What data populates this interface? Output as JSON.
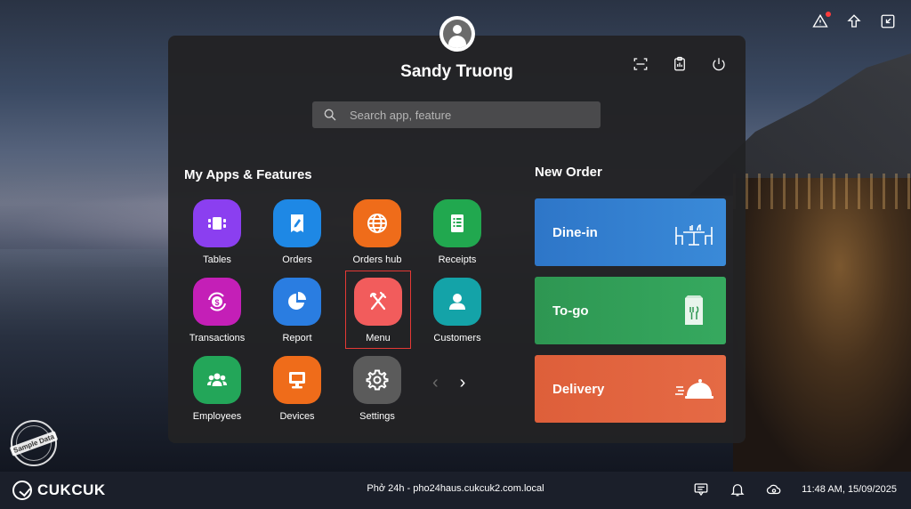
{
  "user": {
    "name": "Sandy Truong"
  },
  "search": {
    "placeholder": "Search app, feature"
  },
  "apps_section": {
    "title": "My Apps & Features",
    "apps": [
      {
        "label": "Tables",
        "icon": "tables-icon",
        "color": "#8b3ff0"
      },
      {
        "label": "Orders",
        "icon": "orders-icon",
        "color": "#1e88e5"
      },
      {
        "label": "Orders hub",
        "icon": "globe-icon",
        "color": "#ef6c1a"
      },
      {
        "label": "Receipts",
        "icon": "receipt-icon",
        "color": "#21a84f"
      },
      {
        "label": "Transactions",
        "icon": "money-icon",
        "color": "#c41fb7"
      },
      {
        "label": "Report",
        "icon": "pie-chart-icon",
        "color": "#2a7de1"
      },
      {
        "label": "Menu",
        "icon": "fork-knife-icon",
        "color": "#f25c5c",
        "selected": true
      },
      {
        "label": "Customers",
        "icon": "customer-icon",
        "color": "#14a3a8"
      },
      {
        "label": "Employees",
        "icon": "employees-icon",
        "color": "#23a659"
      },
      {
        "label": "Devices",
        "icon": "monitor-icon",
        "color": "#ef6c1a"
      },
      {
        "label": "Settings",
        "icon": "gear-icon",
        "color": "#5b5b5b"
      }
    ]
  },
  "new_order": {
    "title": "New Order",
    "options": [
      {
        "label": "Dine-in",
        "icon": "dine-in-icon",
        "color": "#2f7ccf"
      },
      {
        "label": "To-go",
        "icon": "bag-icon",
        "color": "#2f9a55"
      },
      {
        "label": "Delivery",
        "icon": "cloche-icon",
        "color": "#e0643e"
      }
    ]
  },
  "badge": {
    "text": "Sample Data"
  },
  "footer": {
    "brand": "CUKCUK",
    "shop": "Phở 24h - pho24haus.cukcuk2.com.local",
    "datetime": "11:48 AM, 15/09/2025"
  }
}
